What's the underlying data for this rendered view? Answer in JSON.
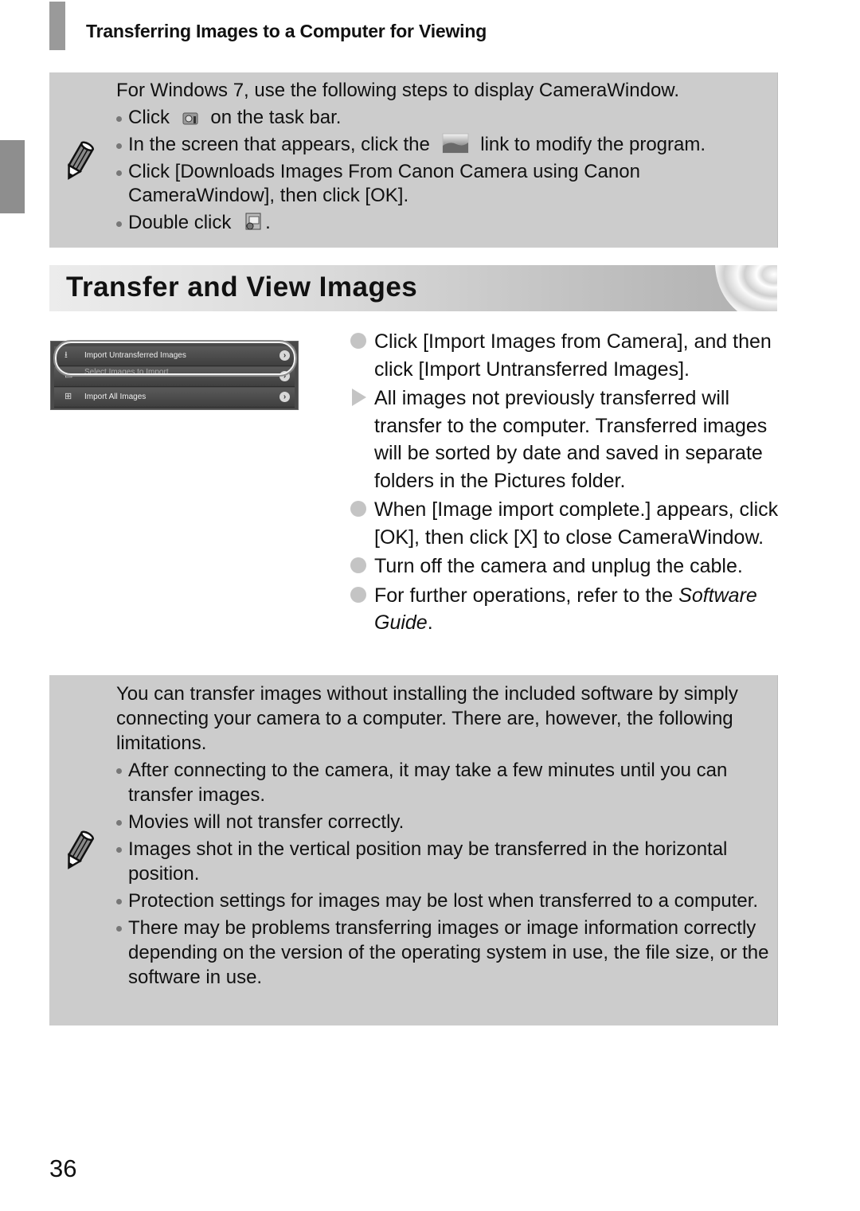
{
  "header": {
    "title": "Transferring Images to a Computer for Viewing"
  },
  "top_note": {
    "icon": "pencil-icon",
    "intro": "For Windows 7, use the following steps to display CameraWindow.",
    "items": [
      {
        "before": "Click",
        "icon": "camera-taskbar-icon",
        "after": "on the task bar."
      },
      {
        "before": "In the screen that appears, click the",
        "icon": "change-program-link-icon",
        "after": "link to modify the program."
      },
      {
        "text": "Click [Downloads Images From Canon Camera using Canon CameraWindow], then click [OK]."
      },
      {
        "before": "Double click",
        "icon": "camerawindow-app-icon",
        "after": "."
      }
    ]
  },
  "section": {
    "title": "Transfer and View Images"
  },
  "screenshot": {
    "rows": [
      {
        "icon": "import-untransferred-icon",
        "label": "Import Untransferred Images",
        "highlighted": true
      },
      {
        "icon": "select-images-icon",
        "label": "Select Images to Import",
        "highlighted": false
      },
      {
        "icon": "import-all-icon",
        "label": "Import All Images",
        "highlighted": false
      }
    ]
  },
  "steps": [
    {
      "marker": "circle",
      "text": "Click [Import Images from Camera], and then click [Import Untransferred Images]."
    },
    {
      "marker": "triangle",
      "text": "All images not previously transferred will transfer to the computer. Transferred images will be sorted by date and saved in separate folders in the Pictures folder."
    },
    {
      "marker": "circle",
      "text": "When [Image import complete.] appears, click [OK], then click [X] to close CameraWindow."
    },
    {
      "marker": "circle",
      "text": "Turn off the camera and unplug the cable."
    },
    {
      "marker": "circle",
      "text_before": "For further operations, refer to the",
      "text_italic": "Software Guide",
      "text_after": "."
    }
  ],
  "bottom_note": {
    "icon": "pencil-icon",
    "intro": "You can transfer images without installing the included software by simply connecting your camera to a computer. There are, however, the following limitations.",
    "items": [
      "After connecting to the camera, it may take a few minutes until you can transfer images.",
      "Movies will not transfer correctly.",
      "Images shot in the vertical position may be transferred in the horizontal position.",
      "Protection settings for images may be lost when transferred to a computer.",
      "There may be problems transferring images or image information correctly depending on the version of the operating system in use, the file size, or the software in use."
    ]
  },
  "page_number": "36"
}
